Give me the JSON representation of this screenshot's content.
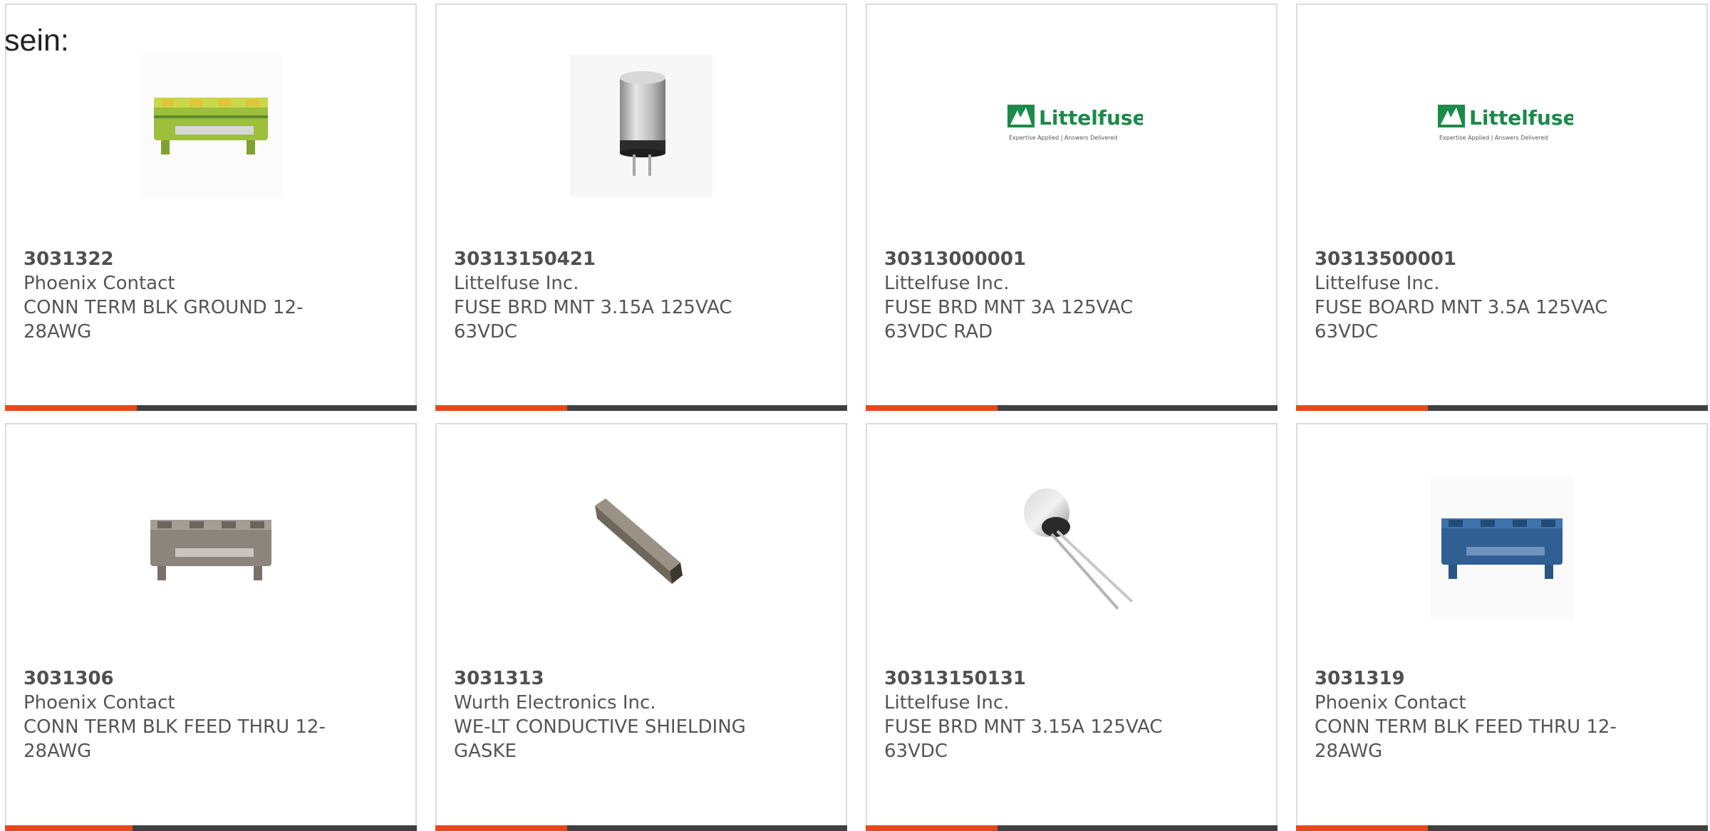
{
  "intro_text": "sein:",
  "accent_color": "#e8471c",
  "bar_color": "#404040",
  "products": [
    {
      "part_number": "3031322",
      "manufacturer": "Phoenix Contact",
      "description": "CONN TERM BLK GROUND 12-28AWG",
      "image": "terminal-block-green-yellow",
      "progress": 0.32
    },
    {
      "part_number": "30313150421",
      "manufacturer": "Littelfuse Inc.",
      "description": "FUSE BRD MNT 3.15A 125VAC 63VDC",
      "image": "fuse-cylinder-silver",
      "progress": 0.32
    },
    {
      "part_number": "30313000001",
      "manufacturer": "Littelfuse Inc.",
      "description": "FUSE BRD MNT 3A 125VAC 63VDC RAD",
      "image": "littelfuse-logo",
      "logo_name": "Littelfuse",
      "logo_tagline": "Expertise Applied | Answers Delivered",
      "progress": 0.32
    },
    {
      "part_number": "30313500001",
      "manufacturer": "Littelfuse Inc.",
      "description": "FUSE BOARD MNT 3.5A 125VAC 63VDC",
      "image": "littelfuse-logo",
      "logo_name": "Littelfuse",
      "logo_tagline": "Expertise Applied | Answers Delivered",
      "progress": 0.32
    },
    {
      "part_number": "3031306",
      "manufacturer": "Phoenix Contact",
      "description": "CONN TERM BLK FEED THRU 12-28AWG",
      "image": "terminal-block-grey",
      "progress": 0.31
    },
    {
      "part_number": "3031313",
      "manufacturer": "Wurth Electronics Inc.",
      "description": "WE-LT CONDUCTIVE SHIELDING GASKE",
      "image": "shielding-gasket-bar",
      "progress": 0.32
    },
    {
      "part_number": "30313150131",
      "manufacturer": "Littelfuse Inc.",
      "description": "FUSE BRD MNT 3.15A 125VAC 63VDC",
      "image": "fuse-radial-leads",
      "progress": 0.32
    },
    {
      "part_number": "3031319",
      "manufacturer": "Phoenix Contact",
      "description": "CONN TERM BLK FEED THRU 12-28AWG",
      "image": "terminal-block-blue",
      "progress": 0.32
    }
  ]
}
